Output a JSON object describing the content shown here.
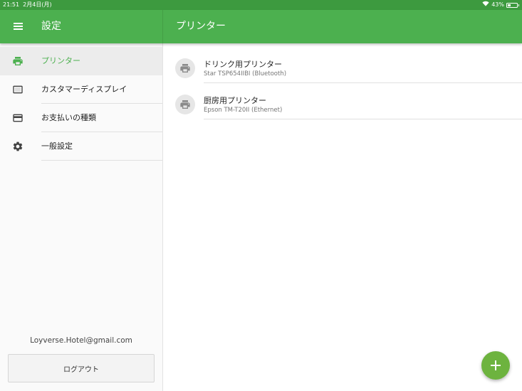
{
  "status_bar": {
    "time": "21:51",
    "date": "2月4日(月)",
    "battery": "43%",
    "battery_level": 0.43
  },
  "app_bar": {
    "app_title": "設定",
    "page_title": "プリンター"
  },
  "sidebar": {
    "items": [
      {
        "label": "プリンター",
        "icon": "printer-icon",
        "active": true
      },
      {
        "label": "カスタマーディスプレイ",
        "icon": "display-icon",
        "active": false
      },
      {
        "label": "お支払いの種類",
        "icon": "credit-card-icon",
        "active": false
      },
      {
        "label": "一般設定",
        "icon": "gear-icon",
        "active": false
      }
    ],
    "email": "Loyverse.Hotel@gmail.com",
    "logout_label": "ログアウト"
  },
  "printers": [
    {
      "name": "ドリンク用プリンター",
      "detail": "Star TSP654IIBI (Bluetooth)",
      "icon": "printer-icon"
    },
    {
      "name": "厨房用プリンター",
      "detail": "Epson TM-T20II (Ethernet)",
      "icon": "printer-icon"
    }
  ],
  "fab": {
    "icon": "plus-icon"
  },
  "colors": {
    "accent": "#4cb04f",
    "status_bar": "#3d9a3f",
    "fab": "#6db33f"
  }
}
